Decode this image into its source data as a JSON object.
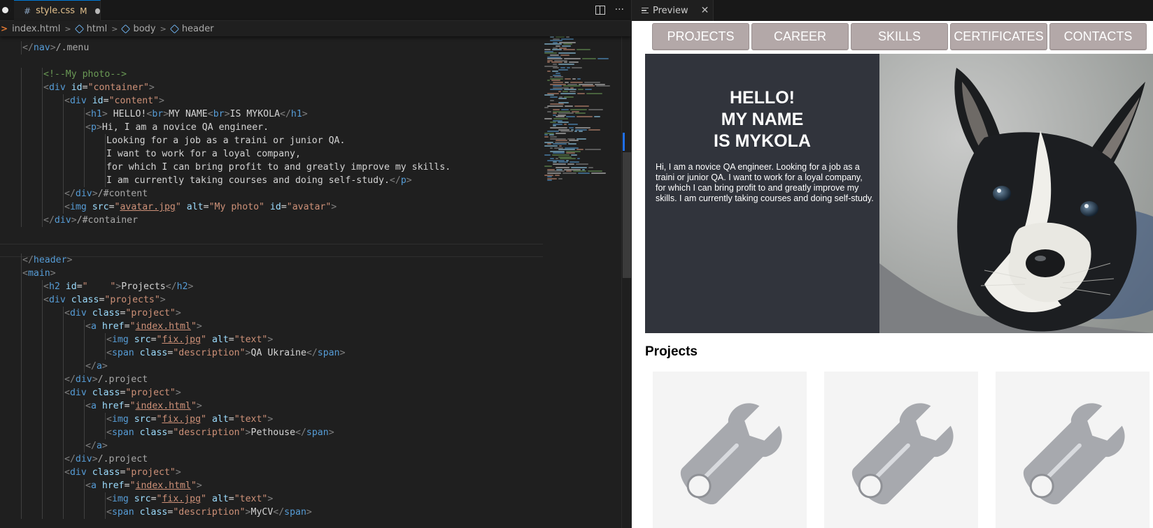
{
  "editor": {
    "tab": {
      "name": "style.css",
      "status": "M"
    },
    "actions": {
      "split": "split-editor",
      "more": "···"
    },
    "breadcrumbs": [
      "index.html",
      "html",
      "body",
      "header"
    ]
  },
  "code_lines": [
    {
      "indent": 1,
      "tokens": [
        [
          "punct",
          "</"
        ],
        [
          "tag",
          "nav"
        ],
        [
          "punct",
          ">"
        ],
        [
          "dim",
          "/.menu"
        ]
      ]
    },
    {
      "indent": 0,
      "tokens": []
    },
    {
      "indent": 2,
      "tokens": [
        [
          "comment",
          "<!--My photo-->"
        ]
      ]
    },
    {
      "indent": 2,
      "tokens": [
        [
          "punct",
          "<"
        ],
        [
          "tag",
          "div"
        ],
        [
          "plain",
          " "
        ],
        [
          "attr",
          "id"
        ],
        [
          "plain",
          "="
        ],
        [
          "str",
          "\"container\""
        ],
        [
          "punct",
          ">"
        ]
      ]
    },
    {
      "indent": 3,
      "tokens": [
        [
          "punct",
          "<"
        ],
        [
          "tag",
          "div"
        ],
        [
          "plain",
          " "
        ],
        [
          "attr",
          "id"
        ],
        [
          "plain",
          "="
        ],
        [
          "str",
          "\"content\""
        ],
        [
          "punct",
          ">"
        ]
      ]
    },
    {
      "indent": 4,
      "tokens": [
        [
          "punct",
          "<"
        ],
        [
          "tag",
          "h1"
        ],
        [
          "punct",
          ">"
        ],
        [
          "plain",
          " HELLO!"
        ],
        [
          "punct",
          "<"
        ],
        [
          "tag",
          "br"
        ],
        [
          "punct",
          ">"
        ],
        [
          "plain",
          "MY NAME"
        ],
        [
          "punct",
          "<"
        ],
        [
          "tag",
          "br"
        ],
        [
          "punct",
          ">"
        ],
        [
          "plain",
          "IS MYKOLA"
        ],
        [
          "punct",
          "</"
        ],
        [
          "tag",
          "h1"
        ],
        [
          "punct",
          ">"
        ]
      ]
    },
    {
      "indent": 4,
      "tokens": [
        [
          "punct",
          "<"
        ],
        [
          "tag",
          "p"
        ],
        [
          "punct",
          ">"
        ],
        [
          "plain",
          "Hi, I am a novice QA engineer."
        ]
      ]
    },
    {
      "indent": 5,
      "tokens": [
        [
          "plain",
          "Looking for a job as a traini or junior QA."
        ]
      ]
    },
    {
      "indent": 5,
      "tokens": [
        [
          "plain",
          "I want to work for a loyal company,"
        ]
      ]
    },
    {
      "indent": 5,
      "tokens": [
        [
          "plain",
          "for which I can bring profit to and greatly improve my skills."
        ]
      ]
    },
    {
      "indent": 5,
      "tokens": [
        [
          "plain",
          "I am currently taking courses and doing self-study."
        ],
        [
          "punct",
          "</"
        ],
        [
          "tag",
          "p"
        ],
        [
          "punct",
          ">"
        ]
      ]
    },
    {
      "indent": 3,
      "tokens": [
        [
          "punct",
          "</"
        ],
        [
          "tag",
          "div"
        ],
        [
          "punct",
          ">"
        ],
        [
          "dim",
          "/#content"
        ]
      ]
    },
    {
      "indent": 3,
      "tokens": [
        [
          "punct",
          "<"
        ],
        [
          "tag",
          "img"
        ],
        [
          "plain",
          " "
        ],
        [
          "attr",
          "src"
        ],
        [
          "plain",
          "="
        ],
        [
          "str",
          "\""
        ],
        [
          "link",
          "avatar.jpg"
        ],
        [
          "str",
          "\""
        ],
        [
          "plain",
          " "
        ],
        [
          "attr",
          "alt"
        ],
        [
          "plain",
          "="
        ],
        [
          "str",
          "\"My photo\""
        ],
        [
          "plain",
          " "
        ],
        [
          "attr",
          "id"
        ],
        [
          "plain",
          "="
        ],
        [
          "str",
          "\"avatar\""
        ],
        [
          "punct",
          ">"
        ]
      ]
    },
    {
      "indent": 2,
      "tokens": [
        [
          "punct",
          "</"
        ],
        [
          "tag",
          "div"
        ],
        [
          "punct",
          ">"
        ],
        [
          "dim",
          "/#container"
        ]
      ]
    },
    {
      "indent": 0,
      "tokens": []
    },
    {
      "indent": 0,
      "tokens": []
    },
    {
      "indent": 1,
      "tokens": [
        [
          "punct",
          "</"
        ],
        [
          "tag",
          "header"
        ],
        [
          "punct",
          ">"
        ]
      ]
    },
    {
      "indent": 1,
      "tokens": [
        [
          "punct",
          "<"
        ],
        [
          "tag",
          "main"
        ],
        [
          "punct",
          ">"
        ]
      ]
    },
    {
      "indent": 2,
      "tokens": [
        [
          "punct",
          "<"
        ],
        [
          "tag",
          "h2"
        ],
        [
          "plain",
          " "
        ],
        [
          "attr",
          "id"
        ],
        [
          "plain",
          "="
        ],
        [
          "str",
          "\"    \""
        ],
        [
          "punct",
          ">"
        ],
        [
          "plain",
          "Projects"
        ],
        [
          "punct",
          "</"
        ],
        [
          "tag",
          "h2"
        ],
        [
          "punct",
          ">"
        ]
      ]
    },
    {
      "indent": 2,
      "tokens": [
        [
          "punct",
          "<"
        ],
        [
          "tag",
          "div"
        ],
        [
          "plain",
          " "
        ],
        [
          "attr",
          "class"
        ],
        [
          "plain",
          "="
        ],
        [
          "str",
          "\"projects\""
        ],
        [
          "punct",
          ">"
        ]
      ]
    },
    {
      "indent": 3,
      "tokens": [
        [
          "punct",
          "<"
        ],
        [
          "tag",
          "div"
        ],
        [
          "plain",
          " "
        ],
        [
          "attr",
          "class"
        ],
        [
          "plain",
          "="
        ],
        [
          "str",
          "\"project\""
        ],
        [
          "punct",
          ">"
        ]
      ]
    },
    {
      "indent": 4,
      "tokens": [
        [
          "punct",
          "<"
        ],
        [
          "tag",
          "a"
        ],
        [
          "plain",
          " "
        ],
        [
          "attr",
          "href"
        ],
        [
          "plain",
          "="
        ],
        [
          "str",
          "\""
        ],
        [
          "link",
          "index.html"
        ],
        [
          "str",
          "\""
        ],
        [
          "punct",
          ">"
        ]
      ]
    },
    {
      "indent": 5,
      "tokens": [
        [
          "punct",
          "<"
        ],
        [
          "tag",
          "img"
        ],
        [
          "plain",
          " "
        ],
        [
          "attr",
          "src"
        ],
        [
          "plain",
          "="
        ],
        [
          "str",
          "\""
        ],
        [
          "link",
          "fix.jpg"
        ],
        [
          "str",
          "\""
        ],
        [
          "plain",
          " "
        ],
        [
          "attr",
          "alt"
        ],
        [
          "plain",
          "="
        ],
        [
          "str",
          "\"text\""
        ],
        [
          "punct",
          ">"
        ]
      ]
    },
    {
      "indent": 5,
      "tokens": [
        [
          "punct",
          "<"
        ],
        [
          "tag",
          "span"
        ],
        [
          "plain",
          " "
        ],
        [
          "attr",
          "class"
        ],
        [
          "plain",
          "="
        ],
        [
          "str",
          "\"description\""
        ],
        [
          "punct",
          ">"
        ],
        [
          "plain",
          "QA Ukraine"
        ],
        [
          "punct",
          "</"
        ],
        [
          "tag",
          "span"
        ],
        [
          "punct",
          ">"
        ]
      ]
    },
    {
      "indent": 4,
      "tokens": [
        [
          "punct",
          "</"
        ],
        [
          "tag",
          "a"
        ],
        [
          "punct",
          ">"
        ]
      ]
    },
    {
      "indent": 3,
      "tokens": [
        [
          "punct",
          "</"
        ],
        [
          "tag",
          "div"
        ],
        [
          "punct",
          ">"
        ],
        [
          "dim",
          "/.project"
        ]
      ]
    },
    {
      "indent": 3,
      "tokens": [
        [
          "punct",
          "<"
        ],
        [
          "tag",
          "div"
        ],
        [
          "plain",
          " "
        ],
        [
          "attr",
          "class"
        ],
        [
          "plain",
          "="
        ],
        [
          "str",
          "\"project\""
        ],
        [
          "punct",
          ">"
        ]
      ]
    },
    {
      "indent": 4,
      "tokens": [
        [
          "punct",
          "<"
        ],
        [
          "tag",
          "a"
        ],
        [
          "plain",
          " "
        ],
        [
          "attr",
          "href"
        ],
        [
          "plain",
          "="
        ],
        [
          "str",
          "\""
        ],
        [
          "link",
          "index.html"
        ],
        [
          "str",
          "\""
        ],
        [
          "punct",
          ">"
        ]
      ]
    },
    {
      "indent": 5,
      "tokens": [
        [
          "punct",
          "<"
        ],
        [
          "tag",
          "img"
        ],
        [
          "plain",
          " "
        ],
        [
          "attr",
          "src"
        ],
        [
          "plain",
          "="
        ],
        [
          "str",
          "\""
        ],
        [
          "link",
          "fix.jpg"
        ],
        [
          "str",
          "\""
        ],
        [
          "plain",
          " "
        ],
        [
          "attr",
          "alt"
        ],
        [
          "plain",
          "="
        ],
        [
          "str",
          "\"text\""
        ],
        [
          "punct",
          ">"
        ]
      ]
    },
    {
      "indent": 5,
      "tokens": [
        [
          "punct",
          "<"
        ],
        [
          "tag",
          "span"
        ],
        [
          "plain",
          " "
        ],
        [
          "attr",
          "class"
        ],
        [
          "plain",
          "="
        ],
        [
          "str",
          "\"description\""
        ],
        [
          "punct",
          ">"
        ],
        [
          "plain",
          "Pethouse"
        ],
        [
          "punct",
          "</"
        ],
        [
          "tag",
          "span"
        ],
        [
          "punct",
          ">"
        ]
      ]
    },
    {
      "indent": 4,
      "tokens": [
        [
          "punct",
          "</"
        ],
        [
          "tag",
          "a"
        ],
        [
          "punct",
          ">"
        ]
      ]
    },
    {
      "indent": 3,
      "tokens": [
        [
          "punct",
          "</"
        ],
        [
          "tag",
          "div"
        ],
        [
          "punct",
          ">"
        ],
        [
          "dim",
          "/.project"
        ]
      ]
    },
    {
      "indent": 3,
      "tokens": [
        [
          "punct",
          "<"
        ],
        [
          "tag",
          "div"
        ],
        [
          "plain",
          " "
        ],
        [
          "attr",
          "class"
        ],
        [
          "plain",
          "="
        ],
        [
          "str",
          "\"project\""
        ],
        [
          "punct",
          ">"
        ]
      ]
    },
    {
      "indent": 4,
      "tokens": [
        [
          "punct",
          "<"
        ],
        [
          "tag",
          "a"
        ],
        [
          "plain",
          " "
        ],
        [
          "attr",
          "href"
        ],
        [
          "plain",
          "="
        ],
        [
          "str",
          "\""
        ],
        [
          "link",
          "index.html"
        ],
        [
          "str",
          "\""
        ],
        [
          "punct",
          ">"
        ]
      ]
    },
    {
      "indent": 5,
      "tokens": [
        [
          "punct",
          "<"
        ],
        [
          "tag",
          "img"
        ],
        [
          "plain",
          " "
        ],
        [
          "attr",
          "src"
        ],
        [
          "plain",
          "="
        ],
        [
          "str",
          "\""
        ],
        [
          "link",
          "fix.jpg"
        ],
        [
          "str",
          "\""
        ],
        [
          "plain",
          " "
        ],
        [
          "attr",
          "alt"
        ],
        [
          "plain",
          "="
        ],
        [
          "str",
          "\"text\""
        ],
        [
          "punct",
          ">"
        ]
      ]
    },
    {
      "indent": 5,
      "tokens": [
        [
          "punct",
          "<"
        ],
        [
          "tag",
          "span"
        ],
        [
          "plain",
          " "
        ],
        [
          "attr",
          "class"
        ],
        [
          "plain",
          "="
        ],
        [
          "str",
          "\"description\""
        ],
        [
          "punct",
          ">"
        ],
        [
          "plain",
          "MyCV"
        ],
        [
          "punct",
          "</"
        ],
        [
          "tag",
          "span"
        ],
        [
          "punct",
          ">"
        ]
      ]
    }
  ],
  "preview": {
    "tab_label": "Preview",
    "nav": [
      "PROJECTS",
      "CAREER",
      "SKILLS",
      "CERTIFICATES",
      "CONTACTS"
    ],
    "hero": {
      "title_lines": [
        "HELLO!",
        "MY NAME",
        "IS MYKOLA"
      ],
      "text": "Hi, I am a novice QA engineer. Looking for a job as a traini or junior QA. I want to work for a loyal company, for which I can bring profit to and greatly improve my skills. I am currently taking courses and doing self-study."
    },
    "projects_heading": "Projects",
    "project_icons": [
      "wrench-icon",
      "wrench-icon",
      "wrench-icon"
    ]
  },
  "colors": {
    "nav_button_bg": "#b3a8a8",
    "hero_bg": "#31343c",
    "project_card_bg": "#f4f4f4",
    "wrench": "#a6a8ad"
  }
}
